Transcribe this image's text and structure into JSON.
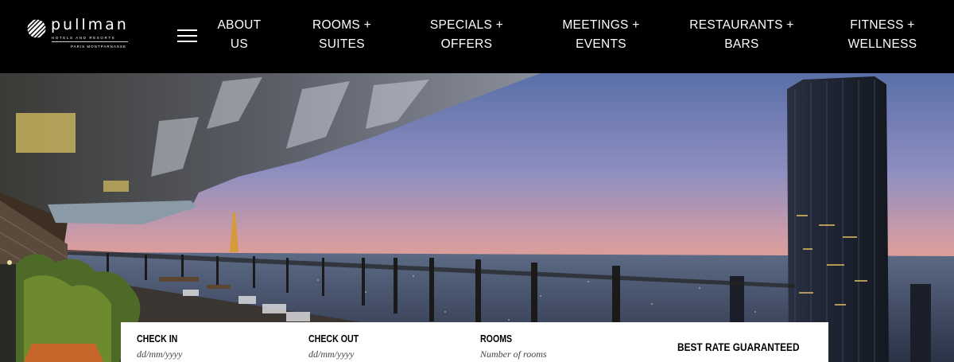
{
  "brand": {
    "name": "pullman",
    "tagline": "HOTELS AND RESORTS",
    "location": "PARIS MONTPARNASSE"
  },
  "nav": {
    "menu_icon": "hamburger-menu-icon",
    "items": [
      {
        "line1": "ABOUT",
        "line2": "US"
      },
      {
        "line1": "ROOMS +",
        "line2": "SUITES"
      },
      {
        "line1": "SPECIALS +",
        "line2": "OFFERS"
      },
      {
        "line1": "MEETINGS +",
        "line2": "EVENTS"
      },
      {
        "line1": "RESTAURANTS +",
        "line2": "BARS"
      },
      {
        "line1": "FITNESS +",
        "line2": "WELLNESS"
      }
    ]
  },
  "booking": {
    "check_in": {
      "label": "CHECK IN",
      "placeholder": "dd/mm/yyyy"
    },
    "check_out": {
      "label": "CHECK OUT",
      "placeholder": "dd/mm/yyyy"
    },
    "rooms": {
      "label": "ROOMS",
      "placeholder": "Number of rooms"
    },
    "best_rate": "BEST RATE GUARANTEED"
  },
  "colors": {
    "header_bg": "#000000",
    "text_light": "#ffffff",
    "panel_bg": "#ffffff"
  }
}
